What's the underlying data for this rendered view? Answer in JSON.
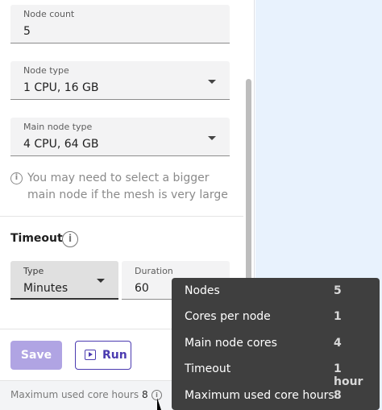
{
  "form": {
    "node_count": {
      "label": "Node count",
      "value": "5"
    },
    "node_type": {
      "label": "Node type",
      "value": "1 CPU, 16 GB"
    },
    "main_node_type": {
      "label": "Main node type",
      "value": "4 CPU, 64 GB"
    },
    "hint": "You may need to select a bigger main node if the mesh is very large"
  },
  "timeout": {
    "title": "Timeout",
    "type": {
      "label": "Type",
      "value": "Minutes"
    },
    "duration": {
      "label": "Duration",
      "value": "60"
    }
  },
  "actions": {
    "save_label": "Save",
    "run_label": "Run"
  },
  "footer": {
    "label": "Maximum used core hours",
    "value": "8"
  },
  "tooltip": {
    "rows": [
      {
        "key": "Nodes",
        "value": "5"
      },
      {
        "key": "Cores per node",
        "value": "1"
      },
      {
        "key": "Main node cores",
        "value": "4"
      },
      {
        "key": "Timeout",
        "value": "1 hour"
      },
      {
        "key": "Maximum used core hours",
        "value": "8"
      }
    ]
  },
  "icons": {
    "info": "info-icon",
    "dropdown": "chevron-down-icon",
    "run": "play-icon"
  },
  "colors": {
    "primary": "#4b3bb0",
    "save_disabled": "#b0a4e3",
    "tooltip_bg": "#3f3f3f",
    "canvas_bg": "#e8f2fd"
  }
}
